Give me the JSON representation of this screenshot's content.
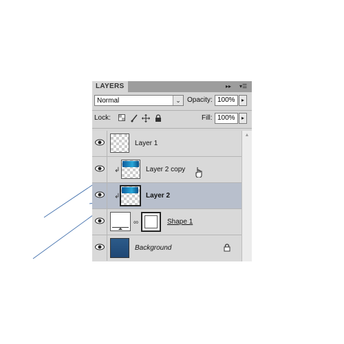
{
  "panel": {
    "tab_title": "LAYERS",
    "collapse_glyph": "▸▸",
    "menu_glyph": "▾☰"
  },
  "blend": {
    "mode": "Normal",
    "dropdown_glyph": "⌄"
  },
  "opacity": {
    "label": "Opacity:",
    "value": "100%",
    "arrow": "▸"
  },
  "lock": {
    "label": "Lock:"
  },
  "fill": {
    "label": "Fill:",
    "value": "100%",
    "arrow": "▸"
  },
  "layers": [
    {
      "name": "Layer 1",
      "selected": false,
      "clipped": false,
      "thumb": "transparent"
    },
    {
      "name": "Layer 2 copy",
      "selected": false,
      "clipped": true,
      "thumb": "image"
    },
    {
      "name": "Layer 2",
      "selected": true,
      "clipped": true,
      "thumb": "image"
    },
    {
      "name": "Shape 1",
      "selected": false,
      "clipped": false,
      "thumb": "shape"
    },
    {
      "name": "Background",
      "selected": false,
      "clipped": false,
      "thumb": "blue",
      "locked": true
    }
  ],
  "colors": {
    "selected_row": "#b8bfcc",
    "background_thumb": "#2c5b8a",
    "annotation_line": "#4a76b0"
  }
}
